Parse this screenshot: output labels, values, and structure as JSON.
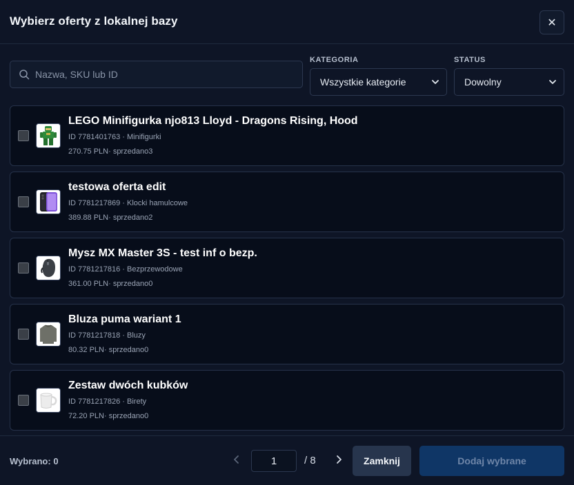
{
  "header": {
    "title": "Wybierz oferty z lokalnej bazy",
    "close_icon": "close-icon",
    "close_glyph": "✕"
  },
  "filters": {
    "search_placeholder": "Nazwa, SKU lub ID",
    "search_value": "",
    "category_label": "KATEGORIA",
    "category_value": "Wszystkie kategorie",
    "status_label": "STATUS",
    "status_value": "Dowolny"
  },
  "items": [
    {
      "name": "LEGO Minifigurka njo813 Lloyd - Dragons Rising, Hood",
      "meta": "ID 7781401763 · Minifigurki",
      "price": "270.75 PLN· sprzedano3",
      "thumb": "lego-minifigure-image",
      "checked": false
    },
    {
      "name": "testowa oferta edit",
      "meta": "ID 7781217869 · Klocki hamulcowe",
      "price": "389.88 PLN· sprzedano2",
      "thumb": "smartphone-image",
      "checked": false
    },
    {
      "name": "Mysz MX Master 3S - test inf o bezp.",
      "meta": "ID 7781217816 · Bezprzewodowe",
      "price": "361.00 PLN· sprzedano0",
      "thumb": "mouse-image",
      "checked": false
    },
    {
      "name": "Bluza puma wariant 1",
      "meta": "ID 7781217818 · Bluzy",
      "price": "80.32 PLN· sprzedano0",
      "thumb": "sweatshirt-image",
      "checked": false
    },
    {
      "name": "Zestaw dwóch kubków",
      "meta": "ID 7781217826 · Birety",
      "price": "72.20 PLN· sprzedano0",
      "thumb": "mug-image",
      "checked": false
    }
  ],
  "footer": {
    "selected_text": "Wybrano: 0",
    "page_value": "1",
    "page_total": "/ 8",
    "close_label": "Zamknij",
    "add_label": "Dodaj wybrane"
  },
  "colors": {
    "background": "#0e1526",
    "card": "#070d1a",
    "border": "#26324a",
    "primary_disabled": "#0f3666"
  }
}
